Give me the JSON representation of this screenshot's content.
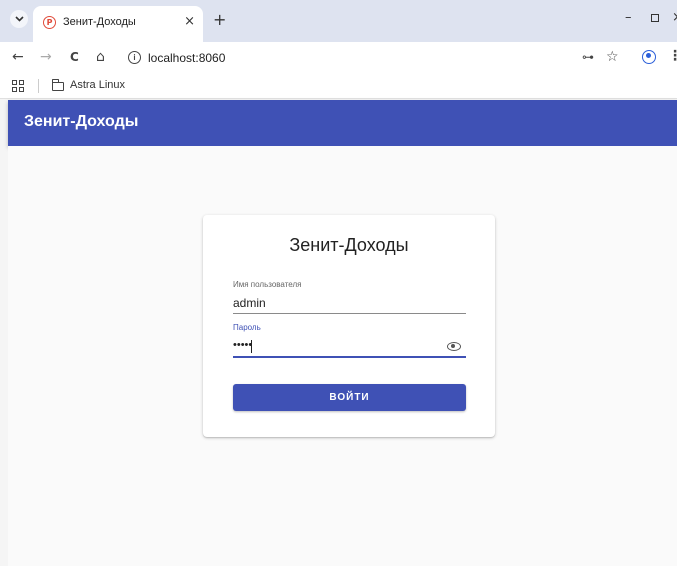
{
  "browser": {
    "tab": {
      "title": "Зенит-Доходы",
      "close": "×"
    },
    "new_tab": "+",
    "window": {
      "minimize": "–",
      "close": "×"
    },
    "nav": {
      "back": "←",
      "forward": "→",
      "reload": "C",
      "home": "⌂"
    },
    "url": "localhost:8060",
    "icons": {
      "key": "⊶",
      "star": "☆",
      "kebab": "⋮"
    },
    "bookmarks": [
      {
        "label": "Astra Linux"
      }
    ]
  },
  "app": {
    "title": "Зенит-Доходы",
    "accent_color": "#3f51b5"
  },
  "login": {
    "title": "Зенит-Доходы",
    "username_label": "Имя пользователя",
    "username_value": "admin",
    "password_label": "Пароль",
    "password_value": "•••••",
    "submit_label": "ВОЙТИ"
  }
}
